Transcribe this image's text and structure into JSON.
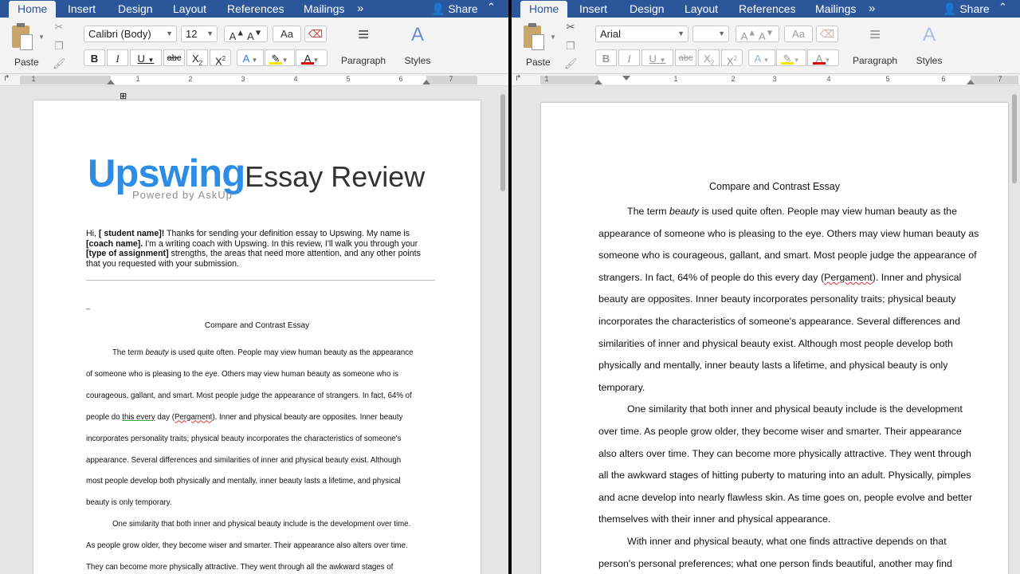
{
  "left": {
    "tabs": [
      {
        "label": "Home",
        "active": true
      },
      {
        "label": "Insert"
      },
      {
        "label": "Design"
      },
      {
        "label": "Layout"
      },
      {
        "label": "References"
      },
      {
        "label": "Mailings"
      }
    ],
    "share_label": "Share",
    "more_tabs": "»",
    "collapse": "⌃",
    "paste_label": "Paste",
    "font_name": "Calibri (Body)",
    "font_size": "12",
    "paragraph_label": "Paragraph",
    "styles_label": "Styles",
    "ruler_numbers": [
      "1",
      "1",
      "2",
      "3",
      "4",
      "5",
      "6",
      "7"
    ],
    "logo": {
      "brand": "Upswing",
      "suffix": "Essay Review",
      "powered": "Powered by AskUp"
    },
    "intro": {
      "hi": "Hi, ",
      "student": "[ student name]!",
      "t1": " Thanks for sending your definition essay to Upswing. My name is ",
      "coach": "[coach name].",
      "t2": " I'm a writing coach with Upswing. In this review, I'll walk you through your ",
      "assignment": "[type of assignment]",
      "t3": " strengths, the areas that need more attention, and any other points that you requested with your submission."
    },
    "dash": "_",
    "essay_title": "Compare and Contrast Essay",
    "lines": [
      "The term ",
      "of someone who is pleasing to the eye. Others may view human beauty as someone who is",
      "courageous, gallant, and smart. Most people judge the appearance of strangers. In fact, 64% of",
      "people do ",
      "incorporates personality traits; physical beauty incorporates the characteristics of someone's",
      "appearance. Several differences and similarities of inner and physical beauty exist. Although",
      "most people develop both physically and mentally, inner beauty lasts a lifetime, and physical",
      "beauty is only temporary.",
      "One similarity that both inner and physical beauty include is the development over time.",
      "As people grow older, they become wiser and smarter. Their appearance also alters over time.",
      "They can become more physically attractive. They went through all the awkward stages of"
    ],
    "l1_beauty": "beauty",
    "l1_rest": " is used quite often. People may view human beauty as the appearance",
    "l4_thisevery": "this every",
    "l4_day": " day (",
    "l4_pergament": "Pergament",
    "l4_rest": "). Inner and physical beauty are opposites. Inner beauty"
  },
  "right": {
    "tabs": [
      {
        "label": "Home",
        "active": true
      },
      {
        "label": "Insert"
      },
      {
        "label": "Design"
      },
      {
        "label": "Layout"
      },
      {
        "label": "References"
      },
      {
        "label": "Mailings"
      }
    ],
    "share_label": "Share",
    "more_tabs": "»",
    "collapse": "⌃",
    "paste_label": "Paste",
    "font_name": "Arial",
    "font_size": "",
    "paragraph_label": "Paragraph",
    "styles_label": "Styles",
    "ruler_numbers": [
      "1",
      "1",
      "2",
      "3",
      "4",
      "5",
      "6",
      "7"
    ],
    "essay_title": "Compare and Contrast Essay",
    "l1_a": "The term ",
    "l1_beauty": "beauty",
    "l1_rest": " is used quite often. People may view human beauty as the",
    "lines": [
      "appearance of someone who is pleasing to the eye. Others may view human beauty as",
      "someone who is courageous, gallant, and smart. Most people judge the appearance of",
      "strangers. In fact, 64% of people do this every day (",
      "beauty are opposites. Inner beauty incorporates personality traits; physical beauty",
      "incorporates the characteristics of someone's appearance. Several differences and",
      "similarities of inner and physical beauty exist. Although most people develop both",
      "physically and mentally, inner beauty lasts a lifetime, and physical beauty is only",
      "temporary.",
      "One similarity that both inner and physical beauty include is the development",
      "over time. As people grow older, they become wiser and smarter. Their appearance",
      "also alters over time. They can become more physically attractive. They went through",
      "all the awkward stages of hitting puberty to maturing into an adult. Physically, pimples",
      "and acne develop into nearly flawless skin. As time goes on, people evolve and better",
      "themselves with their inner and physical appearance.",
      "With inner and physical beauty, what one finds attractive depends on that",
      "person's personal preferences; what one person finds beautiful, another may find"
    ],
    "l4_pergament": "Pergament",
    "l4_rest": "). Inner and physical"
  },
  "colors": {
    "word_blue": "#2b579a",
    "brand_blue": "#2d8de5",
    "highlight": "#f6e500",
    "font_red": "#d40000"
  }
}
